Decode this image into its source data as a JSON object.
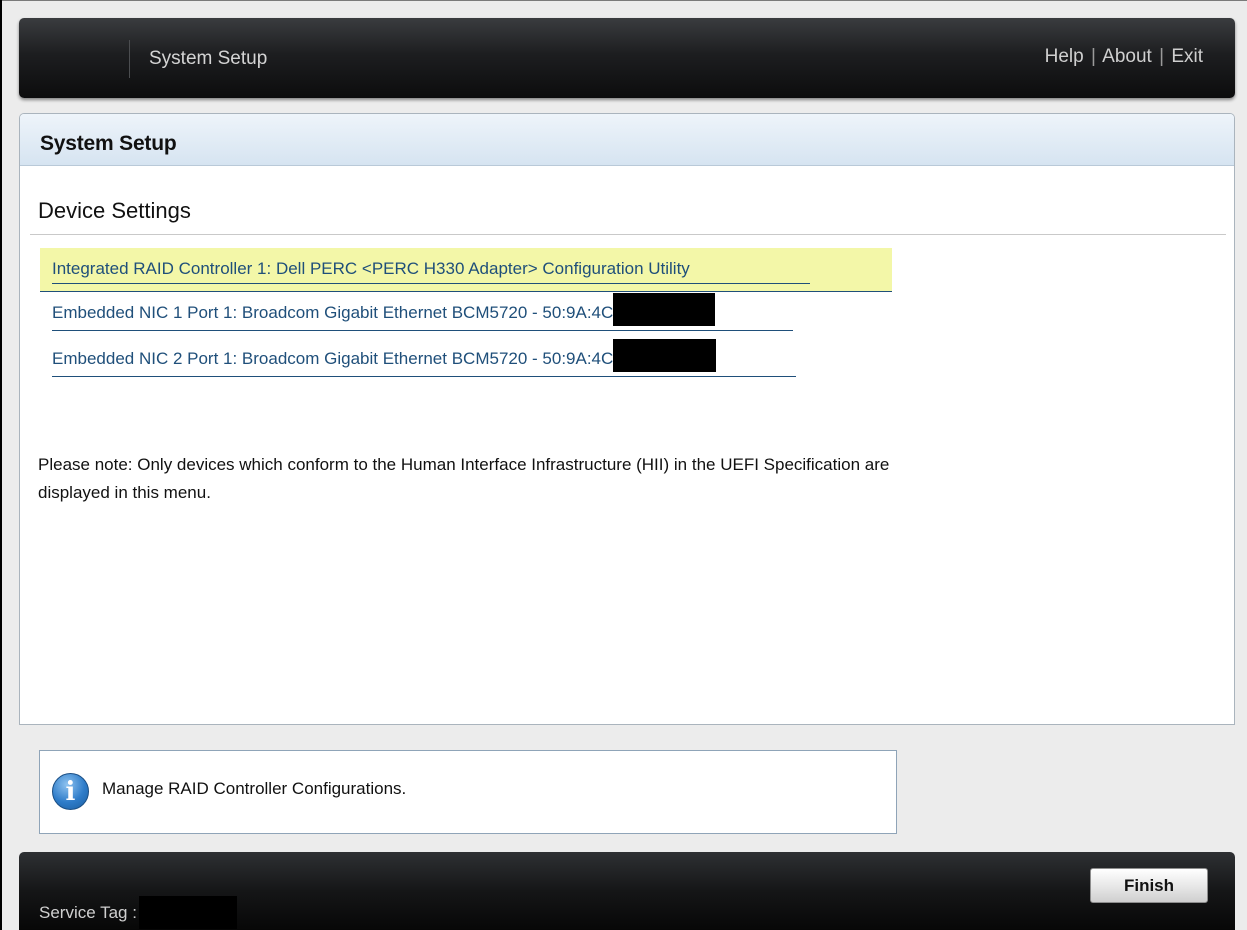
{
  "header": {
    "app_title": "System Setup",
    "links": {
      "help": "Help",
      "about": "About",
      "exit": "Exit",
      "separator": "|"
    }
  },
  "panel": {
    "title": "System Setup",
    "section_title": "Device Settings",
    "devices": [
      {
        "label": "Integrated RAID Controller 1: Dell PERC <PERC H330 Adapter> Configuration Utility",
        "selected": true
      },
      {
        "label": "Embedded NIC 1 Port 1: Broadcom Gigabit Ethernet BCM5720 - 50:9A:4C",
        "redacted_suffix": true
      },
      {
        "label": "Embedded NIC 2 Port 1: Broadcom Gigabit Ethernet BCM5720 - 50:9A:4C",
        "redacted_suffix": true
      }
    ],
    "note": "Please note: Only devices which conform to the Human Interface Infrastructure (HII) in the UEFI Specification are displayed in this menu."
  },
  "help_box": {
    "icon": "info-icon",
    "text": "Manage RAID Controller Configurations."
  },
  "footer": {
    "service_tag_label": "Service Tag : ",
    "finish_label": "Finish"
  },
  "colors": {
    "link": "#1f4f7a",
    "selected_highlight": "#f3f7a8",
    "panel_header": "#d6e4f1",
    "bar_dark": "#151617"
  }
}
